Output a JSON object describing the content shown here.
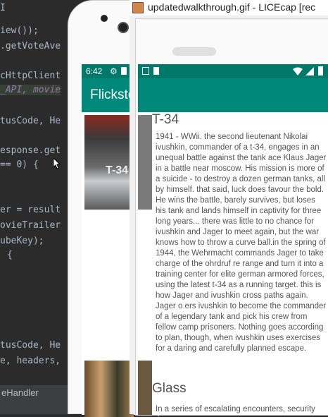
{
  "window": {
    "title": "updatedwalkthrough.gif - LICEcap [rec"
  },
  "ide": {
    "lines": [
      "iew());",
      ".getVoteAve",
      "cHttpClient",
      "_API, movie",
      "tusCode, He",
      "esponse.get",
      "== 0) {",
      "er = result",
      "ovieTrailer",
      "ubeKey);",
      "{",
      "tusCode, He",
      "e, headers,"
    ],
    "bottom_label": "eHandler"
  },
  "phone_left": {
    "time": "6:42",
    "app_title": "Flickster"
  },
  "app": {
    "app_title": "Flickster",
    "movies": [
      {
        "title": "T-34",
        "overview": "1941 - WWii. the second lieutenant Nikolai ivushkin, commander of a t-34, engages in an unequal battle against the tank ace Klaus Jager in a battle near moscow. His mission is more of a suicide - to destroy a dozen german tanks, all by himself. that said, luck does favour the bold. He wins the battle, barely survives, but loses his tank and lands himself in captivity for three long years... there was little to no chance for ivushkin and Jager to meet again, but the war knows how to throw a curve ball.in the spring of 1944, the Wehrmacht commands Jager to take charge of the ohrdruf  re range and turn it into a training center for elite german armored forces, using the latest t-34 as a running target. this is how Jager and ivushkin cross paths again. Jager o ers ivushkin to become the commander of a legendary tank and pick his crew from fellow camp prisoners. Nothing goes according to plan, though, when ivushkin uses exercises for a daring and carefully planned escape."
      },
      {
        "title": "Glass",
        "overview": "In a series of escalating encounters, security guard David Dunn uses his supernatural abilities to track Kevin Wendell Crumb, a"
      }
    ]
  }
}
